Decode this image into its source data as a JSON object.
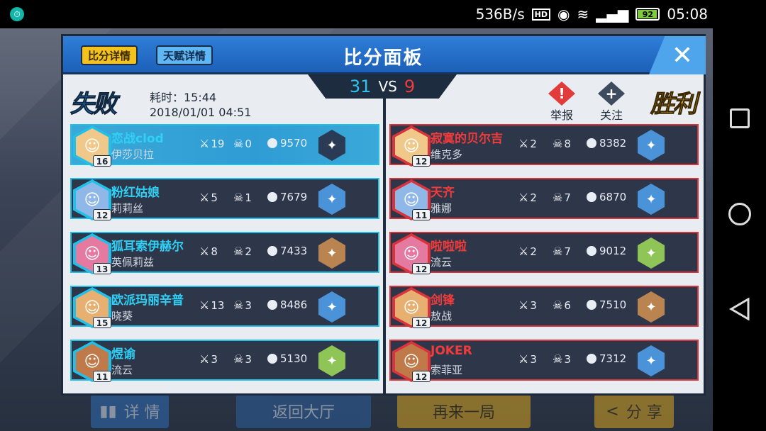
{
  "statusbar": {
    "speed": "536B/s",
    "hd": "HD",
    "battery": "92",
    "time": "05:08"
  },
  "background": {
    "details": "详 情",
    "lobby": "返回大厅",
    "again": "再来一局",
    "share": "分 享"
  },
  "panel": {
    "tab_score": "比分详情",
    "tab_talent": "天赋详情",
    "title": "比分面板",
    "close": "✕",
    "score_left": "31",
    "score_vs": "VS",
    "score_right": "9",
    "left_result": "失败",
    "right_result": "胜利",
    "duration": "耗时：15:44",
    "datetime": "2018/01/01 04:51",
    "report": "举报",
    "follow": "关注"
  },
  "left_team": [
    {
      "name": "恋战clod",
      "hero": "伊莎贝拉",
      "level": "16",
      "kills": "19",
      "deaths": "0",
      "gold": "9570",
      "me": true
    },
    {
      "name": "粉红姑娘",
      "hero": "莉莉丝",
      "level": "12",
      "kills": "5",
      "deaths": "1",
      "gold": "7679"
    },
    {
      "name": "狐耳索伊赫尔",
      "hero": "英佩莉兹",
      "level": "13",
      "kills": "8",
      "deaths": "2",
      "gold": "7433"
    },
    {
      "name": "欧派玛丽辛普",
      "hero": "晓葵",
      "level": "15",
      "kills": "13",
      "deaths": "3",
      "gold": "8486"
    },
    {
      "name": "煜谕",
      "hero": "流云",
      "level": "11",
      "kills": "3",
      "deaths": "3",
      "gold": "5130"
    }
  ],
  "right_team": [
    {
      "name": "寂寞的贝尔吉",
      "hero": "维克多",
      "level": "12",
      "kills": "2",
      "deaths": "8",
      "gold": "8382"
    },
    {
      "name": "天齐",
      "hero": "雅娜",
      "level": "11",
      "kills": "2",
      "deaths": "7",
      "gold": "6870"
    },
    {
      "name": "啦啦啦",
      "hero": "流云",
      "level": "12",
      "kills": "2",
      "deaths": "7",
      "gold": "9012"
    },
    {
      "name": "剑锋",
      "hero": "敖战",
      "level": "12",
      "kills": "3",
      "deaths": "6",
      "gold": "7510"
    },
    {
      "name": "JOKER",
      "hero": "索菲亚",
      "level": "12",
      "kills": "3",
      "deaths": "3",
      "gold": "7312"
    }
  ],
  "colors": {
    "header_blue": "#1c5fb8",
    "left_accent": "#22c0e8",
    "right_accent": "#d9343c",
    "score_left": "#2dc3f0",
    "score_right": "#ef3b3b"
  }
}
